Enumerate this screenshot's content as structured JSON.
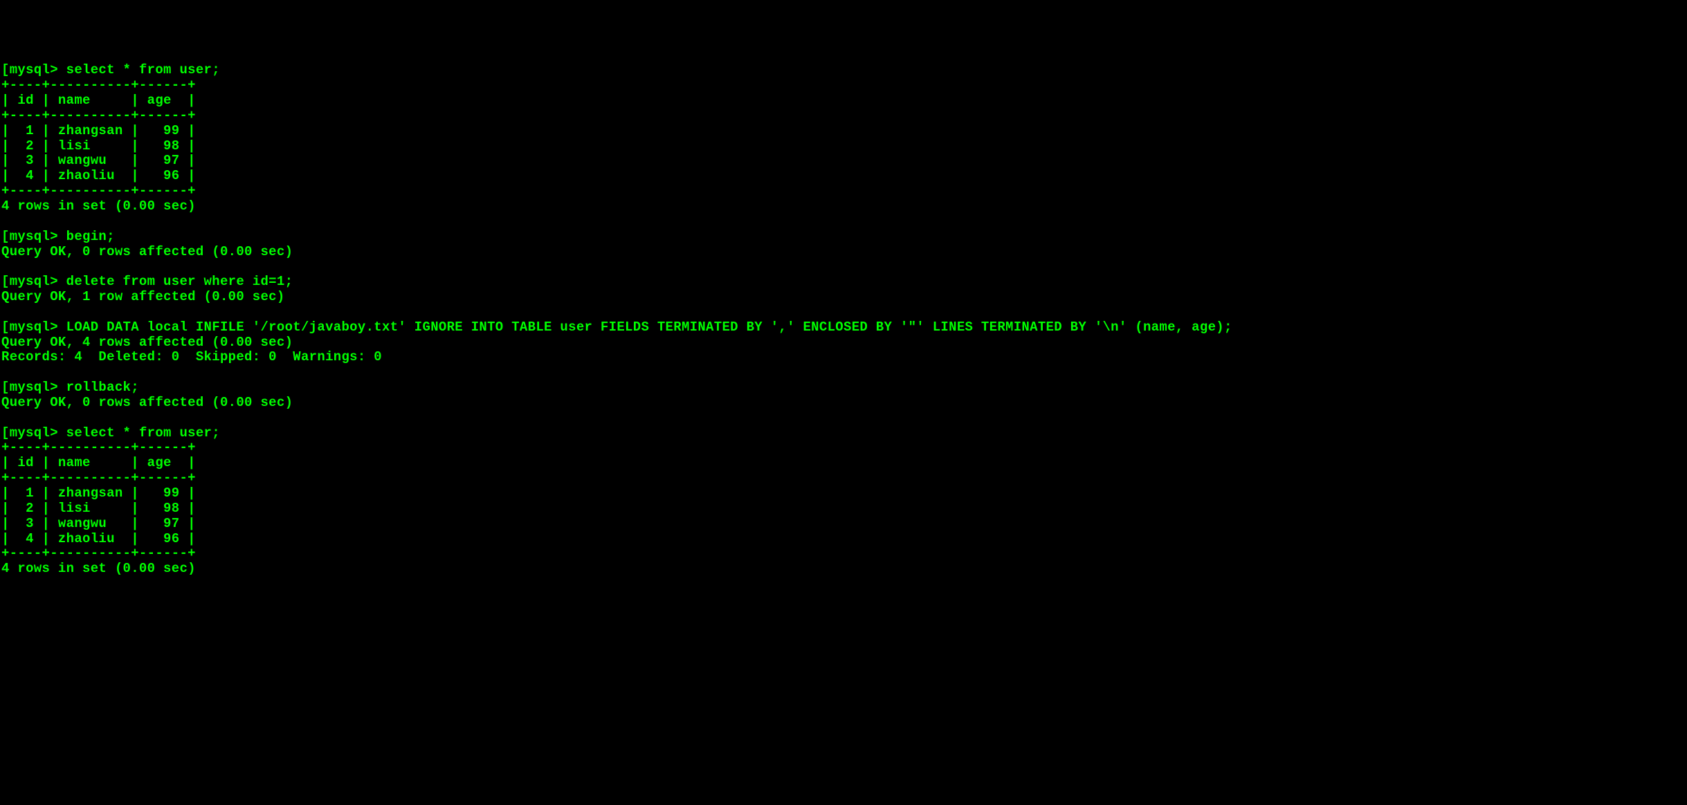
{
  "prompt": "mysql>",
  "bracket": "[",
  "blocks": [
    {
      "type": "command",
      "text": "select * from user;"
    },
    {
      "type": "table",
      "border": "+----+----------+------+",
      "header": "| id | name     | age  |",
      "rows": [
        "|  1 | zhangsan |   99 |",
        "|  2 | lisi     |   98 |",
        "|  3 | wangwu   |   97 |",
        "|  4 | zhaoliu  |   96 |"
      ],
      "footer": "4 rows in set (0.00 sec)"
    },
    {
      "type": "blank"
    },
    {
      "type": "command",
      "text": "begin;"
    },
    {
      "type": "result",
      "text": "Query OK, 0 rows affected (0.00 sec)"
    },
    {
      "type": "blank"
    },
    {
      "type": "command",
      "text": "delete from user where id=1;"
    },
    {
      "type": "result",
      "text": "Query OK, 1 row affected (0.00 sec)"
    },
    {
      "type": "blank"
    },
    {
      "type": "command",
      "text": "LOAD DATA local INFILE '/root/javaboy.txt' IGNORE INTO TABLE user FIELDS TERMINATED BY ',' ENCLOSED BY '\"' LINES TERMINATED BY '\\n' (name, age);"
    },
    {
      "type": "result",
      "text": "Query OK, 4 rows affected (0.00 sec)"
    },
    {
      "type": "result",
      "text": "Records: 4  Deleted: 0  Skipped: 0  Warnings: 0"
    },
    {
      "type": "blank"
    },
    {
      "type": "command",
      "text": "rollback;"
    },
    {
      "type": "result",
      "text": "Query OK, 0 rows affected (0.00 sec)"
    },
    {
      "type": "blank"
    },
    {
      "type": "command",
      "text": "select * from user;"
    },
    {
      "type": "table",
      "border": "+----+----------+------+",
      "header": "| id | name     | age  |",
      "rows": [
        "|  1 | zhangsan |   99 |",
        "|  2 | lisi     |   98 |",
        "|  3 | wangwu   |   97 |",
        "|  4 | zhaoliu  |   96 |"
      ],
      "footer": "4 rows in set (0.00 sec)"
    }
  ]
}
